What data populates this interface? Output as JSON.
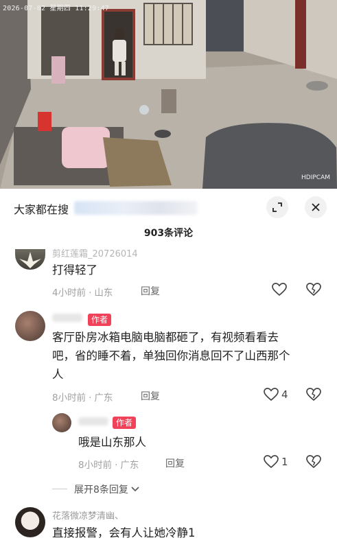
{
  "video": {
    "timestamp": "2026-07-02  星期四  11:29:47",
    "watermark": "HDIPCAM"
  },
  "sheet": {
    "header_title": "大家都在搜",
    "comment_count": "903条评论"
  },
  "comments": [
    {
      "username": "剪红莲霜_20726014",
      "text_lines": [
        "打得轻了"
      ],
      "time": "4小时前",
      "location": "山东",
      "reply_label": "回复",
      "likes": ""
    },
    {
      "username": "",
      "author_badge": "作者",
      "text_lines": [
        "客厅卧房冰箱电脑电脑都砸了，有视频看看去",
        "吧，省的睡不着，单独回你消息回不了山西那个",
        "人"
      ],
      "time": "8小时前",
      "location": "广东",
      "reply_label": "回复",
      "likes": "4"
    },
    {
      "username": "",
      "author_badge": "作者",
      "text_lines": [
        "哦是山东那人"
      ],
      "time": "8小时前",
      "location": "广东",
      "reply_label": "回复",
      "likes": "1"
    },
    {
      "username": "花落微凉梦清幽、",
      "text_lines": [
        "直接报警，会有人让她冷静1"
      ]
    }
  ],
  "expand_label": "展开8条回复",
  "colors": {
    "author_badge": "#f0435a",
    "meta": "#a0a0a0"
  },
  "icons": [
    "expand-icon",
    "close-icon",
    "heart-icon",
    "broken-heart-icon",
    "chevron-down-icon"
  ]
}
